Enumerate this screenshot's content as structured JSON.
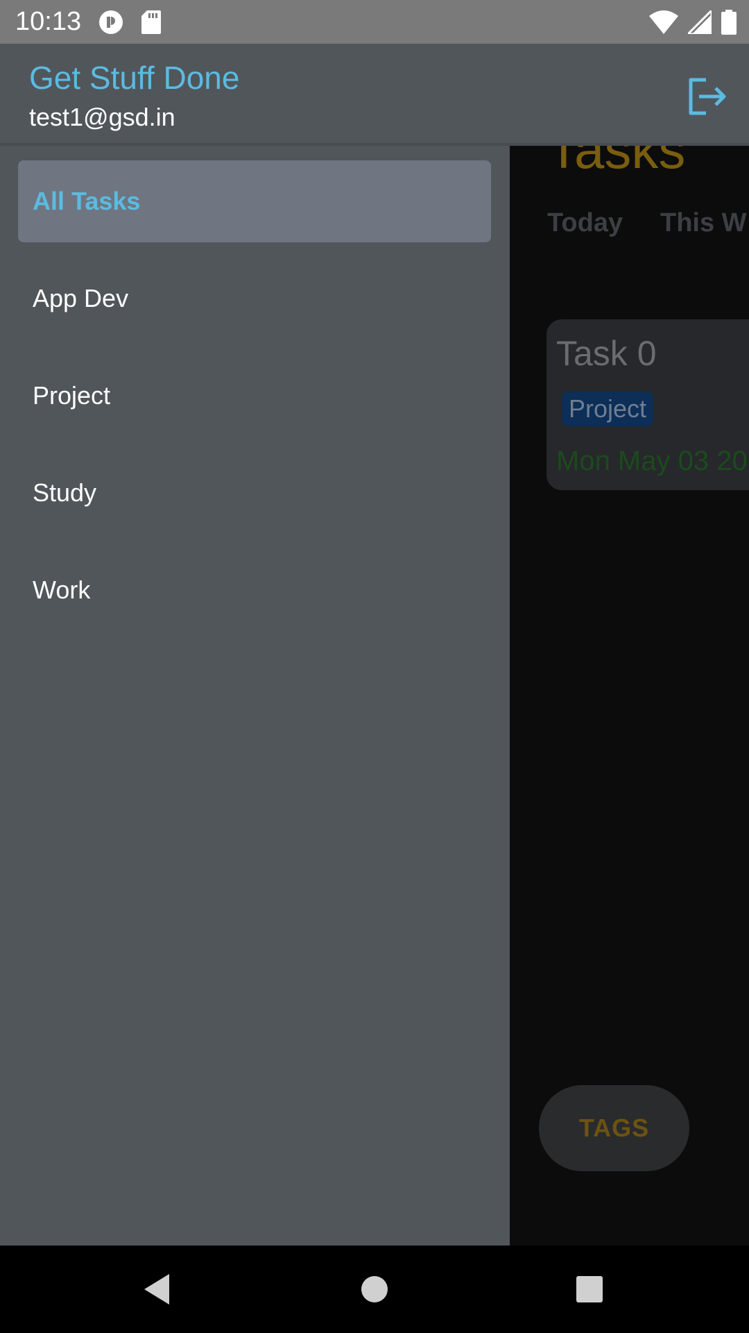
{
  "status_bar": {
    "time": "10:13",
    "icons_left": [
      "sync-icon",
      "sd-card-icon"
    ],
    "icons_right": [
      "wifi-icon",
      "cell-signal-icon",
      "battery-icon"
    ]
  },
  "drawer_header": {
    "app_title": "Get Stuff Done",
    "user_email": "test1@gsd.in",
    "logout_icon": "logout-icon"
  },
  "drawer": {
    "items": [
      {
        "label": "All Tasks",
        "active": true
      },
      {
        "label": "App Dev",
        "active": false
      },
      {
        "label": "Project",
        "active": false
      },
      {
        "label": "Study",
        "active": false
      },
      {
        "label": "Work",
        "active": false
      }
    ]
  },
  "main": {
    "title": "Tasks",
    "tabs": [
      {
        "label": "Today"
      },
      {
        "label": "This W"
      }
    ],
    "task": {
      "title": "Task 0",
      "tag": "Project",
      "date": "Mon May 03 20"
    },
    "tags_button": "TAGS"
  },
  "nav_bar": {
    "buttons": [
      "back-icon",
      "home-icon",
      "recents-icon"
    ]
  },
  "colors": {
    "accent": "#5bbbe0",
    "drawer_bg": "#51565b",
    "active_item_bg": "#6f7681",
    "title_gold": "#7a5e0f"
  }
}
